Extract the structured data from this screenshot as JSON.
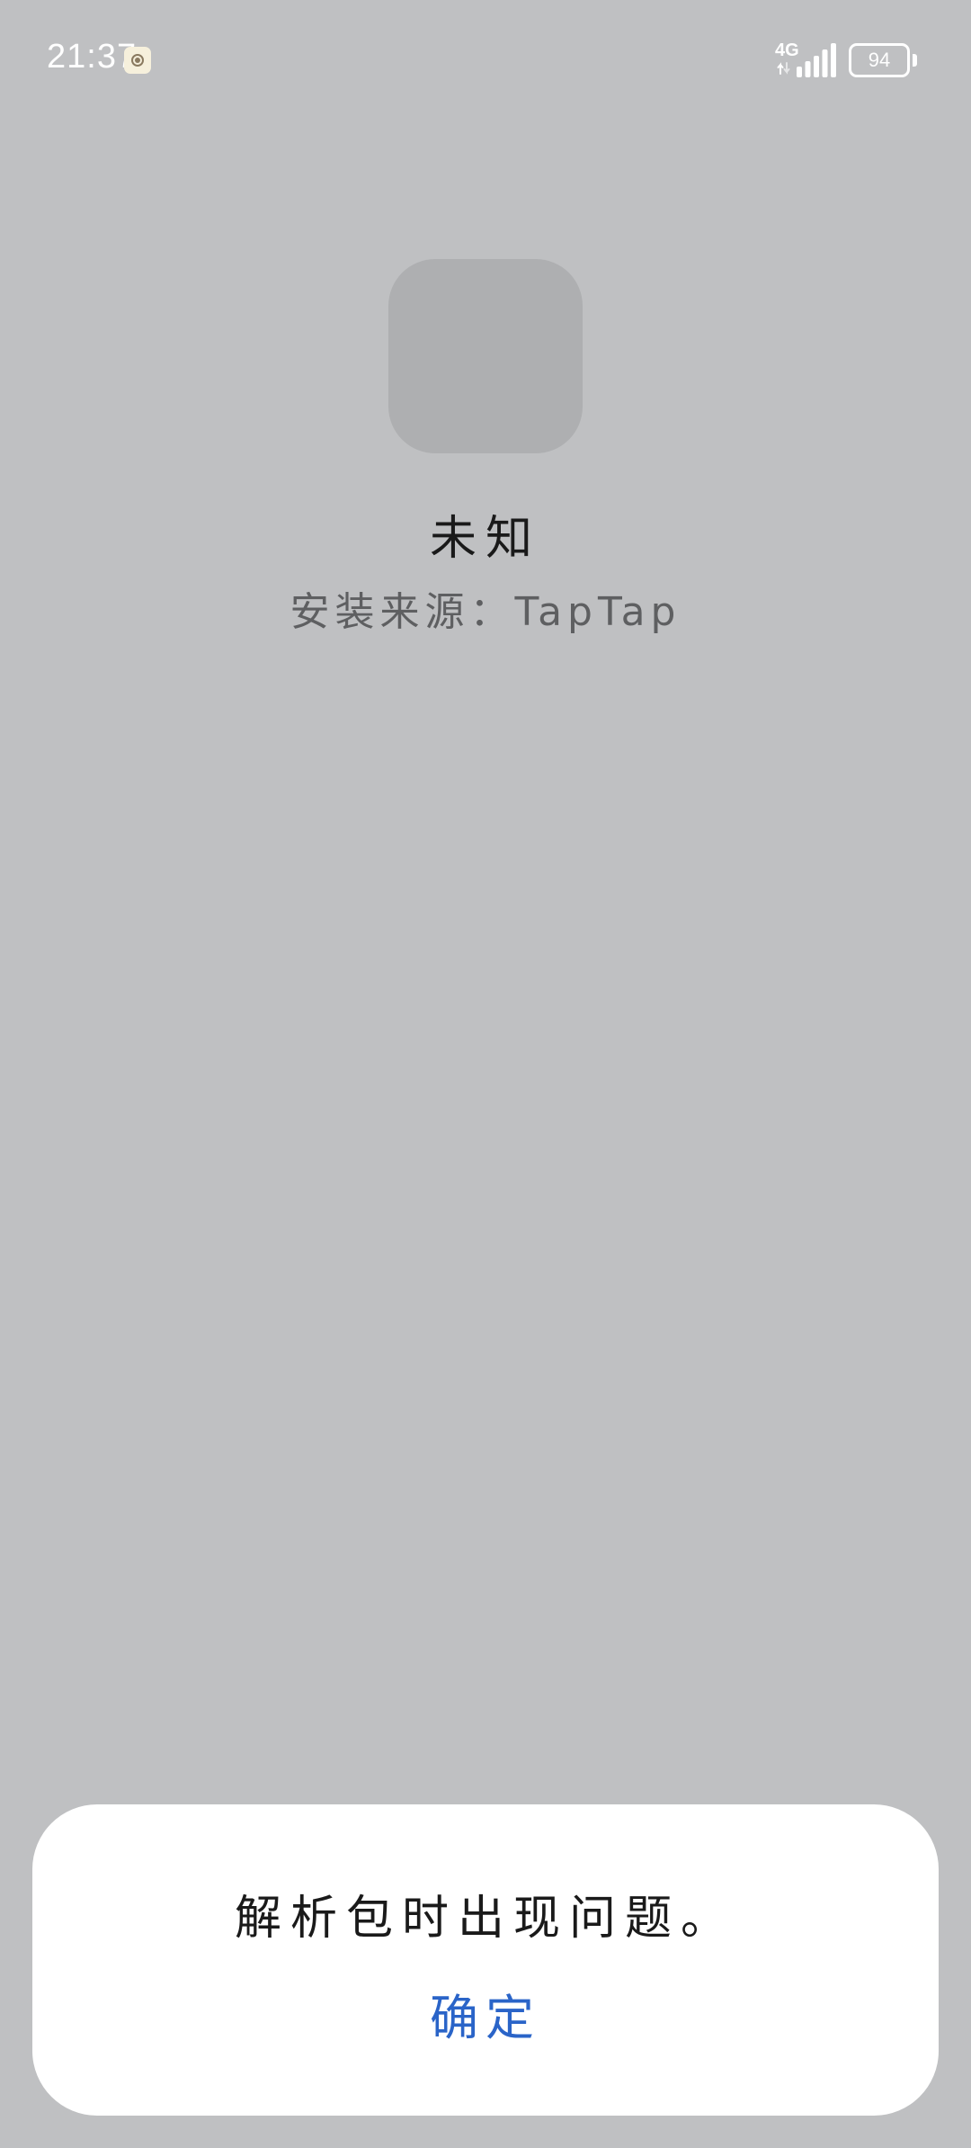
{
  "status_bar": {
    "time": "21:37",
    "network": "4G",
    "battery": "94",
    "notification_icon": "app-notification-icon",
    "signal_icon": "signal-bars-icon",
    "battery_icon": "battery-icon"
  },
  "app_info": {
    "icon": "app-icon-placeholder",
    "name": "未知",
    "install_source": "安装来源：TapTap"
  },
  "dialog": {
    "message": "解析包时出现问题。",
    "confirm_label": "确定"
  },
  "colors": {
    "background": "#BFC0C2",
    "dialog_background": "#FFFFFF",
    "accent": "#2A64C8"
  }
}
